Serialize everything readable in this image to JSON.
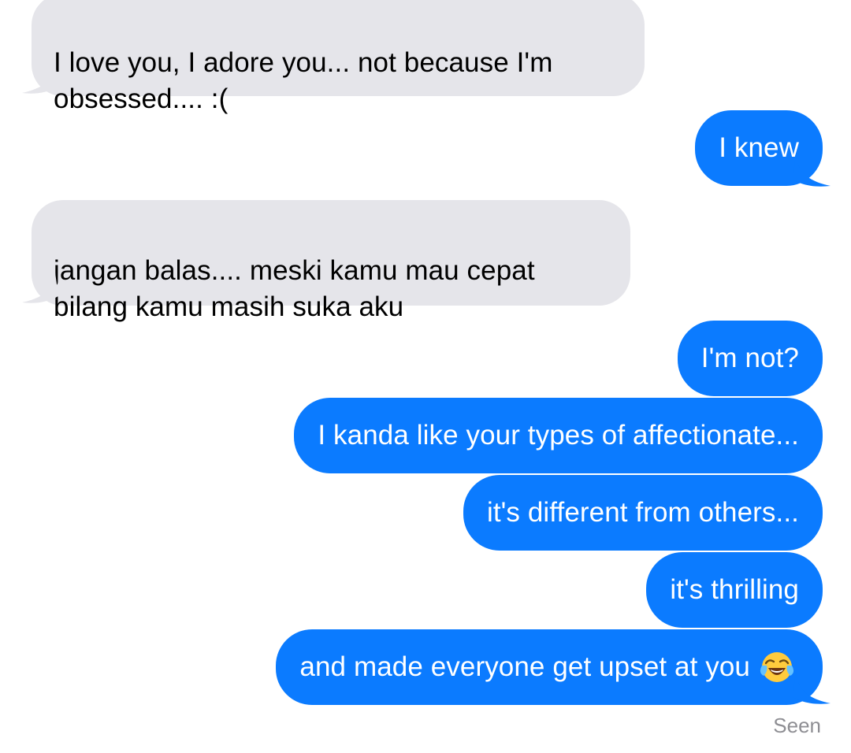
{
  "conversation": {
    "messages": [
      {
        "direction": "incoming",
        "text": "I love you, I adore you... not because I'm\nobsessed.... :("
      },
      {
        "direction": "outgoing",
        "text": "I knew"
      },
      {
        "direction": "incoming",
        "text": "jangan balas.... meski kamu mau cepat\nbilang kamu masih suka aku"
      },
      {
        "direction": "outgoing",
        "text": "I'm not?"
      },
      {
        "direction": "outgoing",
        "text": "I kanda like your types of affectionate..."
      },
      {
        "direction": "outgoing",
        "text": "it's different from others..."
      },
      {
        "direction": "outgoing",
        "text": "it's thrilling"
      },
      {
        "direction": "outgoing",
        "text": "and made everyone get upset at you",
        "emoji": "face-with-tears-of-joy"
      }
    ],
    "read_receipt": "Seen"
  },
  "colors": {
    "incoming_bubble": "#e5e5ea",
    "outgoing_bubble": "#0b7bff",
    "incoming_text": "#000000",
    "outgoing_text": "#ffffff",
    "receipt_text": "#8e8e93"
  }
}
